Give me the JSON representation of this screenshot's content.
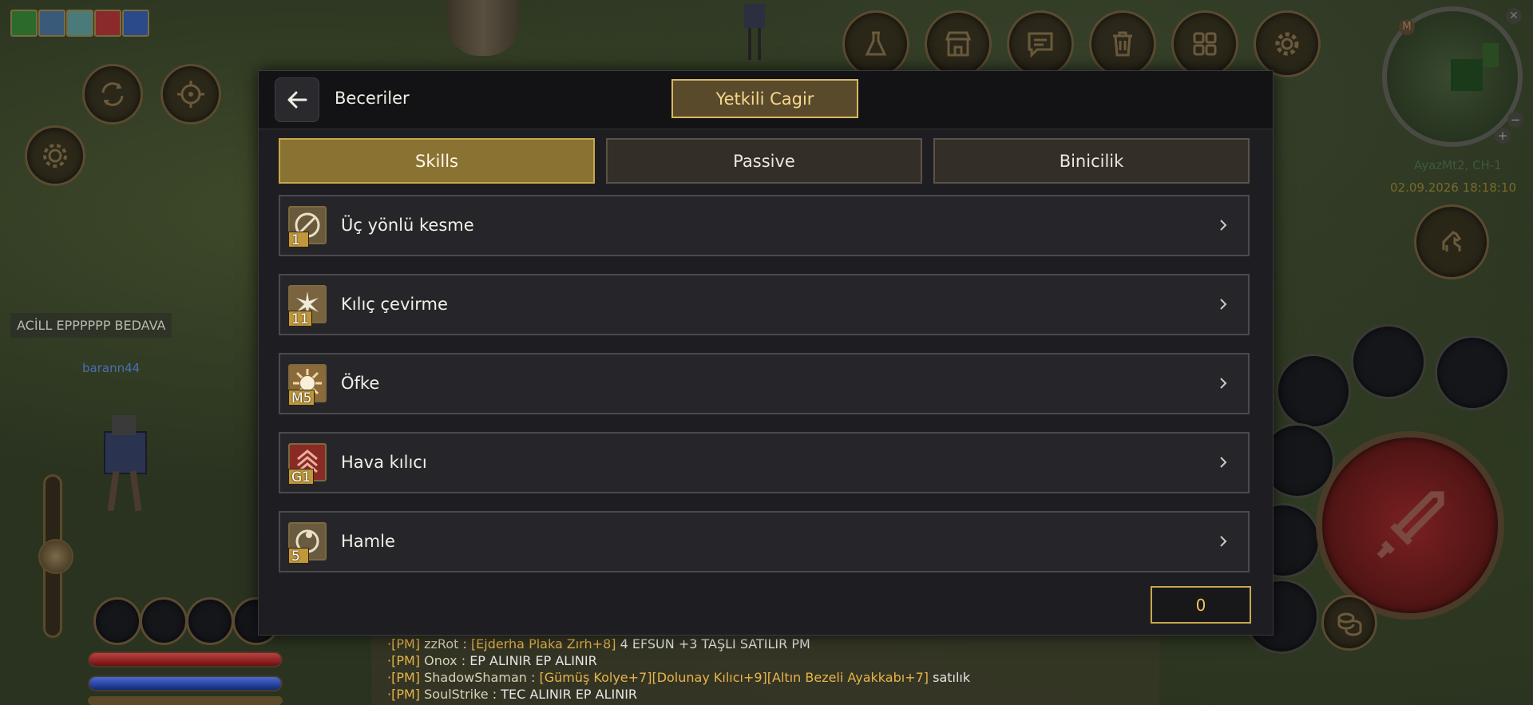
{
  "hud": {
    "server_name": "AyazMt2, CH-1",
    "datetime": "02.09.2026 18:18:10",
    "shout_text": "ACİLL EPPPPPP BEDAVA",
    "player_name": "barann44",
    "minimap_m": "M",
    "minimap_plus": "+",
    "minimap_minus": "−"
  },
  "dialog": {
    "title": "Beceriler",
    "call_button": "Yetkili Cagir",
    "tabs": [
      {
        "label": "Skills",
        "active": true
      },
      {
        "label": "Passive",
        "active": false
      },
      {
        "label": "Binicilik",
        "active": false
      }
    ],
    "skills": [
      {
        "name": "Üç yönlü kesme",
        "level": "1",
        "icon": "three-way-cut-icon"
      },
      {
        "name": "Kılıç çevirme",
        "level": "11",
        "icon": "sword-spin-icon"
      },
      {
        "name": "Öfke",
        "level": "M5",
        "icon": "aura-icon"
      },
      {
        "name": "Hava kılıcı",
        "level": "G1",
        "icon": "air-sword-icon"
      },
      {
        "name": "Hamle",
        "level": "5",
        "icon": "dash-icon"
      }
    ],
    "skill_points": "0"
  },
  "chat": [
    {
      "tag": "[PM]",
      "sender": "zzRot : ",
      "parts": [
        {
          "t": "[Ejderha Plaka Zırh+8]",
          "c": "gold"
        },
        {
          "t": " 4 EFSUN +3 TAŞLI SATILIR PM",
          "c": "white"
        }
      ]
    },
    {
      "tag": "[PM]",
      "sender": "Onox : ",
      "parts": [
        {
          "t": "EP   ALINIR     EP   ALINIR",
          "c": "white"
        }
      ]
    },
    {
      "tag": "[PM]",
      "sender": "ShadowShaman : ",
      "parts": [
        {
          "t": "[Gümüş Kolye+7][Dolunay Kılıcı+9][Altın Bezeli Ayakkabı+7]",
          "c": "gold"
        },
        {
          "t": " satılık",
          "c": "white"
        }
      ]
    },
    {
      "tag": "[PM]",
      "sender": "SoulStrike : ",
      "parts": [
        {
          "t": " TEC ALINIR EP ALINIR",
          "c": "white"
        }
      ]
    }
  ],
  "colors": {
    "accent_gold": "#c8a84e",
    "tab_active": "#8a7232",
    "panel": "#1e1e22"
  }
}
